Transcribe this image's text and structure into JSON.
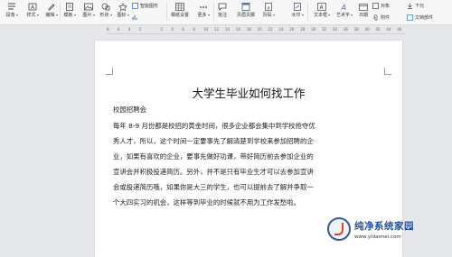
{
  "toolbar": {
    "buttons": [
      {
        "label": "段落",
        "icon": "paragraph-icon"
      },
      {
        "label": "样式",
        "icon": "style-icon"
      },
      {
        "label": "编辑",
        "icon": "edit-icon"
      },
      {
        "label": "模板",
        "icon": "template-icon"
      },
      {
        "label": "图片",
        "icon": "picture-icon"
      },
      {
        "label": "形状",
        "icon": "shape-icon"
      },
      {
        "label": "图标",
        "icon": "icon-icon"
      },
      {
        "label": "稿纸设置",
        "icon": "manuscript-icon"
      },
      {
        "label": "更多",
        "icon": "more-icon"
      },
      {
        "label": "批注",
        "icon": "comment-icon"
      },
      {
        "label": "页眉页脚",
        "icon": "header-footer-icon"
      },
      {
        "label": "页码",
        "icon": "page-number-icon"
      },
      {
        "label": "水印",
        "icon": "watermark-icon"
      },
      {
        "label": "文本框",
        "icon": "textbox-icon"
      },
      {
        "label": "艺术字",
        "icon": "art-text-icon"
      },
      {
        "label": "日期",
        "icon": "date-icon"
      }
    ],
    "smart_graphic": "智能图形",
    "object": "对象",
    "doc_parts": "文档部件",
    "attachment": "附件",
    "download": "下元"
  },
  "ruler": {
    "ticks": [
      "8",
      "6",
      "4",
      "2",
      "",
      "2",
      "4",
      "6",
      "8",
      "10",
      "12",
      "14",
      "16",
      "18",
      "20",
      "22",
      "24",
      "26",
      "28",
      "30",
      "32",
      "34",
      "36",
      "38",
      "40",
      "42",
      "44",
      "46"
    ]
  },
  "document": {
    "title": "大学生毕业如何找工作",
    "heading": "校园招聘会",
    "lines": [
      "每年 8-9 月份都是校招的黄金时间，很多企业都会集中到学校抢夺优",
      "秀人才，所以，这个时间一定要事先了解清楚到学校来参加招聘的企",
      "业，如果有喜欢的企业，要事先做好功课，带好简历前去参加企业的",
      "宣讲会并积极投递简历。另外，并不是只有毕业生才可以去参加宣讲",
      "会或投递简历哦，如果你是大三的学生，也可以提前去了解并争取一",
      "个大四实习的机会，这样等到毕业的时候就不用为工作发愁啦。"
    ]
  },
  "watermark": {
    "title": "纯净系统家园",
    "url": "www.yidaimei.com"
  }
}
